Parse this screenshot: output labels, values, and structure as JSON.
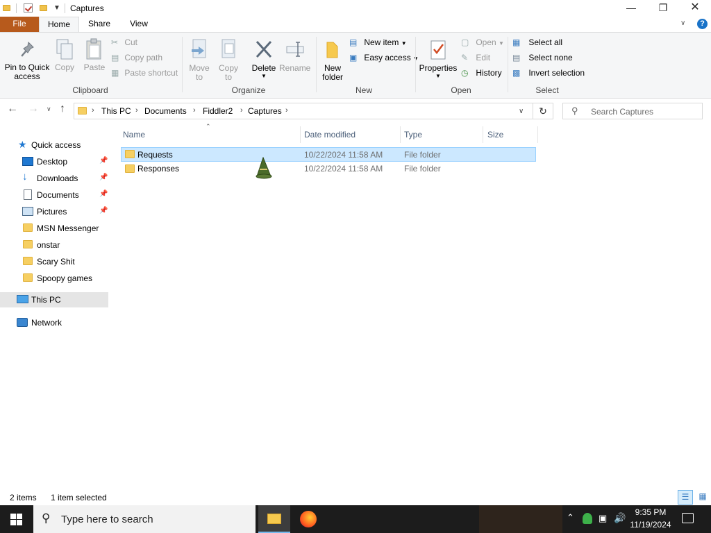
{
  "window": {
    "title": "Captures",
    "minimize_icon": "minimize-icon",
    "maximize_icon": "restore-icon",
    "close_icon": "close-icon"
  },
  "ribbon_tabs": [
    "File",
    "Home",
    "Share",
    "View"
  ],
  "ribbon": {
    "clipboard": {
      "label": "Clipboard",
      "pin": "Pin to Quick access",
      "pin_line1": "Pin to Quick",
      "pin_line2": "access",
      "copy": "Copy",
      "paste": "Paste",
      "cut": "Cut",
      "copy_path": "Copy path",
      "paste_shortcut": "Paste shortcut"
    },
    "organize": {
      "label": "Organize",
      "move_to_1": "Move",
      "move_to_2": "to",
      "copy_to_1": "Copy",
      "copy_to_2": "to",
      "delete": "Delete",
      "rename": "Rename"
    },
    "new": {
      "label": "New",
      "new_folder_1": "New",
      "new_folder_2": "folder",
      "new_item": "New item",
      "easy_access": "Easy access"
    },
    "open": {
      "label": "Open",
      "properties": "Properties",
      "open": "Open",
      "edit": "Edit",
      "history": "History"
    },
    "select": {
      "label": "Select",
      "select_all": "Select all",
      "select_none": "Select none",
      "invert_selection": "Invert selection"
    }
  },
  "address": {
    "crumbs": [
      "This PC",
      "Documents",
      "Fiddler2",
      "Captures"
    ],
    "search_placeholder": "Search Captures"
  },
  "sidebar": {
    "quick_access": "Quick access",
    "items": [
      {
        "label": "Desktop",
        "pinned": true
      },
      {
        "label": "Downloads",
        "pinned": true
      },
      {
        "label": "Documents",
        "pinned": true
      },
      {
        "label": "Pictures",
        "pinned": true
      },
      {
        "label": "MSN Messenger",
        "pinned": false
      },
      {
        "label": "onstar",
        "pinned": false
      },
      {
        "label": "Scary Shit",
        "pinned": false
      },
      {
        "label": "Spoopy games",
        "pinned": false
      }
    ],
    "this_pc": "This PC",
    "network": "Network"
  },
  "columns": [
    "Name",
    "Date modified",
    "Type",
    "Size"
  ],
  "files": [
    {
      "name": "Requests",
      "date": "10/22/2024 11:58 AM",
      "type": "File folder",
      "size": "",
      "selected": true
    },
    {
      "name": "Responses",
      "date": "10/22/2024 11:58 AM",
      "type": "File folder",
      "size": "",
      "selected": false
    }
  ],
  "status": {
    "count": "2 items",
    "selected": "1 item selected"
  },
  "taskbar": {
    "search_placeholder": "Type here to search",
    "time": "9:35 PM",
    "date": "11/19/2024"
  },
  "colors": {
    "accent": "#b75a1c",
    "selection": "#cce8ff",
    "taskbar": "#1c1c1c"
  }
}
